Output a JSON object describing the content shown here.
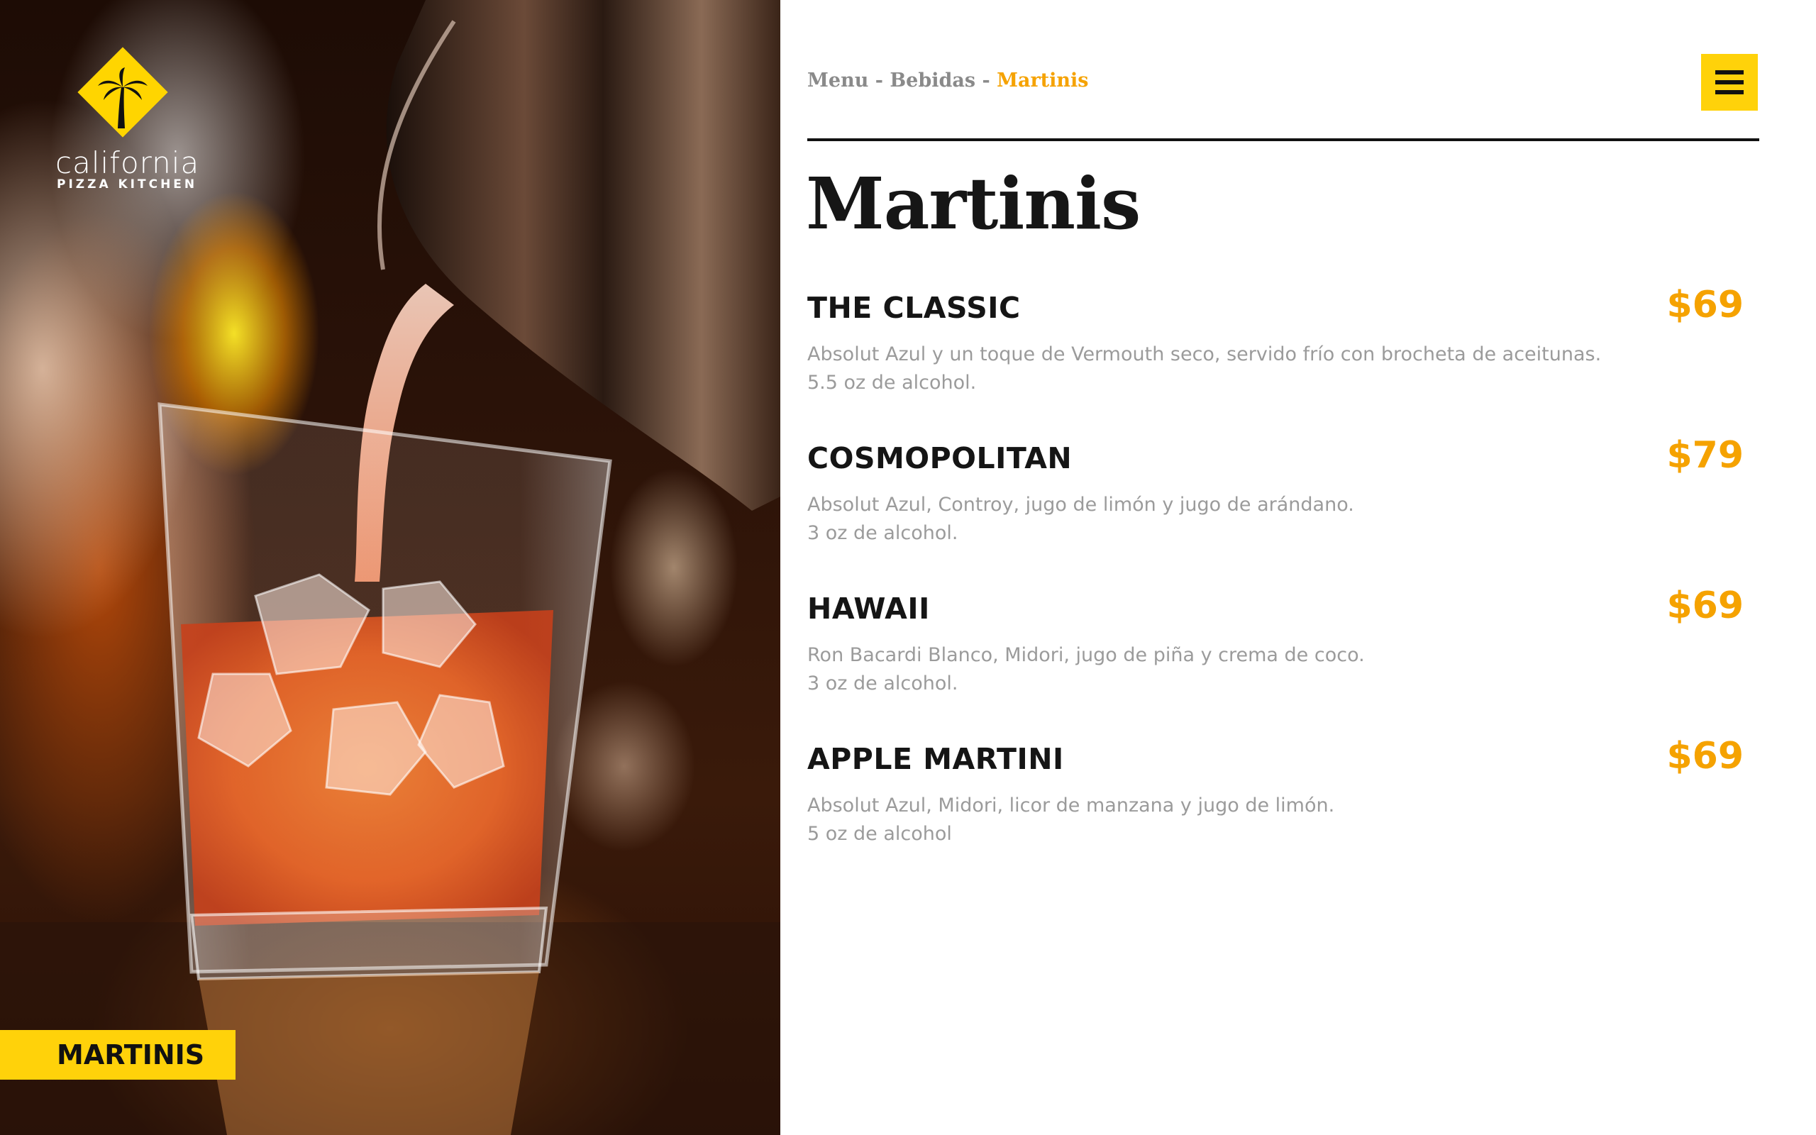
{
  "brand": {
    "wordmark": "california",
    "sub": "PIZZA KITCHEN",
    "color": "#ffd500"
  },
  "hero": {
    "category_tag": "MARTINIS"
  },
  "breadcrumb": {
    "items": [
      "Menu",
      "Bebidas"
    ],
    "separator": " - ",
    "current": "Martinis"
  },
  "header": {
    "menu_icon": "hamburger-menu-icon"
  },
  "page_title": "Martinis",
  "colors": {
    "accent": "#ffd20a",
    "price": "#f5a200",
    "title": "#161616",
    "description": "#9b9b9b"
  },
  "menu_items": [
    {
      "name": "THE CLASSIC",
      "price": "$69",
      "description": "Absolut Azul y un toque de Vermouth seco, servido frío con brocheta de aceitunas.",
      "alcohol": "5.5 oz de alcohol."
    },
    {
      "name": "COSMOPOLITAN",
      "price": "$79",
      "description": "Absolut Azul, Controy, jugo de limón y jugo de arándano.",
      "alcohol": "3 oz de alcohol."
    },
    {
      "name": "HAWAII",
      "price": "$69",
      "description": "Ron Bacardi Blanco, Midori, jugo de piña y crema de coco.",
      "alcohol": "3 oz de alcohol."
    },
    {
      "name": "APPLE MARTINI",
      "price": "$69",
      "description": "Absolut Azul, Midori, licor de manzana y jugo de limón.",
      "alcohol": "5 oz de alcohol"
    }
  ]
}
